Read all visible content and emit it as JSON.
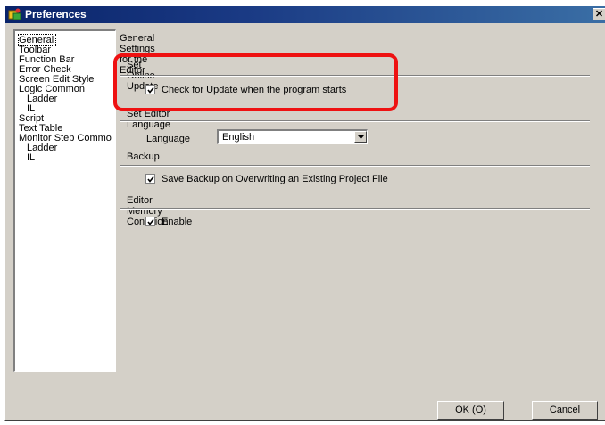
{
  "window": {
    "title": "Preferences",
    "close_glyph": "✕"
  },
  "sidebar": {
    "items": [
      {
        "label": "General",
        "selected": true
      },
      {
        "label": "Toolbar"
      },
      {
        "label": "Function Bar"
      },
      {
        "label": "Error Check"
      },
      {
        "label": "Screen Edit Style"
      },
      {
        "label": "Logic Common"
      },
      {
        "label": "Ladder"
      },
      {
        "label": "IL"
      },
      {
        "label": "Script"
      },
      {
        "label": "Text Table"
      },
      {
        "label": "Monitor Step Commo"
      },
      {
        "label": "Ladder"
      },
      {
        "label": "IL"
      }
    ]
  },
  "main": {
    "header": "General Settings for the Editor",
    "online_update": {
      "section": "Set Online Update",
      "checkbox_label": "Check for Update when the program starts",
      "checked": true
    },
    "editor_language": {
      "section": "Set Editor Language",
      "field_label": "Language",
      "selected_value": "English"
    },
    "backup": {
      "section": "Backup",
      "checkbox_label": "Save Backup on Overwriting an Existing Project File",
      "checked": true
    },
    "memory": {
      "section": "Editor Memory Condition",
      "checkbox_label": "Enable",
      "checked": true
    }
  },
  "buttons": {
    "ok": "OK (O)",
    "cancel": "Cancel"
  },
  "colors": {
    "titlebar": "#0a246a",
    "highlight": "#ee1111",
    "dialog_bg": "#d4d0c8"
  }
}
